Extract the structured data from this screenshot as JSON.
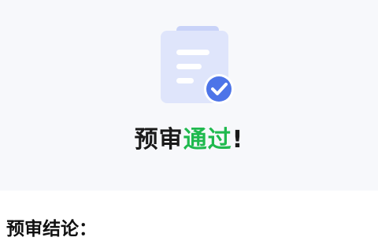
{
  "result": {
    "title_prefix": "预审",
    "title_highlight": "通过",
    "title_suffix": "!",
    "highlight_color": "#1fb94e"
  },
  "section": {
    "label": "预审结论："
  },
  "icons": {
    "status": "clipboard-check-icon"
  },
  "colors": {
    "hero_background": "#f7f8fb",
    "clipboard": "#dfe5fb",
    "check_badge": "#4d74e8"
  }
}
